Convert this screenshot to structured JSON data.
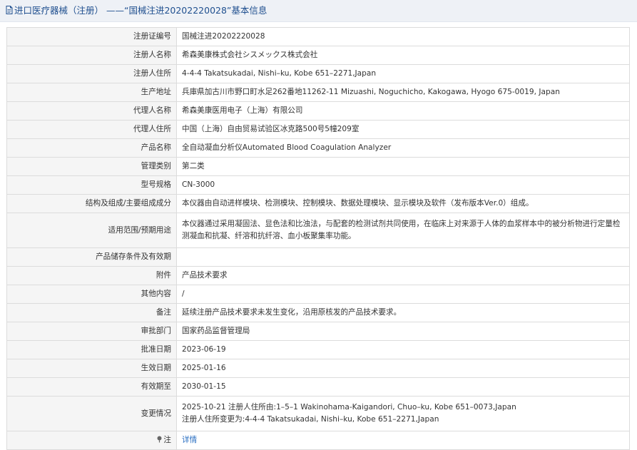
{
  "header": {
    "title": "进口医疗器械（注册） ——“国械注进20202220028”基本信息",
    "icon": "document-icon"
  },
  "rows": [
    {
      "label": "注册证编号",
      "value": "国械注进20202220028"
    },
    {
      "label": "注册人名称",
      "value": "希森美康株式会社シスメックス株式会社"
    },
    {
      "label": "注册人住所",
      "value": "4-4-4 Takatsukadai, Nishi–ku, Kobe 651–2271,Japan"
    },
    {
      "label": "生产地址",
      "value": "兵庫県加古川市野口町水足262番地11262-11 Mizuashi, Noguchicho, Kakogawa, Hyogo 675-0019, Japan"
    },
    {
      "label": "代理人名称",
      "value": "希森美康医用电子（上海）有限公司"
    },
    {
      "label": "代理人住所",
      "value": "中国（上海）自由贸易试验区冰克路500号5幢209室"
    },
    {
      "label": "产品名称",
      "value": "全自动凝血分析仪Automated Blood Coagulation Analyzer"
    },
    {
      "label": "管理类别",
      "value": "第二类"
    },
    {
      "label": "型号规格",
      "value": "CN-3000"
    },
    {
      "label": "结构及组成/主要组成成分",
      "value": "本仪器由自动进样模块、检测模块、控制模块、数据处理模块、显示模块及软件（发布版本Ver.0）组成。"
    },
    {
      "label": "适用范围/预期用途",
      "value": "本仪器通过采用凝固法、显色法和比浊法，与配套的检测试剂共同使用，在临床上对来源于人体的血浆样本中的被分析物进行定量检测凝血和抗凝、纤溶和抗纤溶、血小板聚集率功能。"
    },
    {
      "label": "产品储存条件及有效期",
      "value": ""
    },
    {
      "label": "附件",
      "value": "产品技术要求"
    },
    {
      "label": "其他内容",
      "value": "/"
    },
    {
      "label": "备注",
      "value": "延续注册产品技术要求未发生变化，沿用原核发的产品技术要求。"
    },
    {
      "label": "审批部门",
      "value": "国家药品监督管理局"
    },
    {
      "label": "批准日期",
      "value": "2023-06-19"
    },
    {
      "label": "生效日期",
      "value": "2025-01-16"
    },
    {
      "label": "有效期至",
      "value": "2030-01-15"
    },
    {
      "label": "变更情况",
      "value_line1": "2025-10-21 注册人住所由:1–5–1 Wakinohama-Kaigandori, Chuo–ku, Kobe 651–0073,Japan",
      "value_line2": "注册人住所变更为:4-4-4 Takatsukadai, Nishi–ku, Kobe 651–2271,Japan"
    },
    {
      "label": "注",
      "value": "详情",
      "icon": "pin-icon"
    }
  ]
}
